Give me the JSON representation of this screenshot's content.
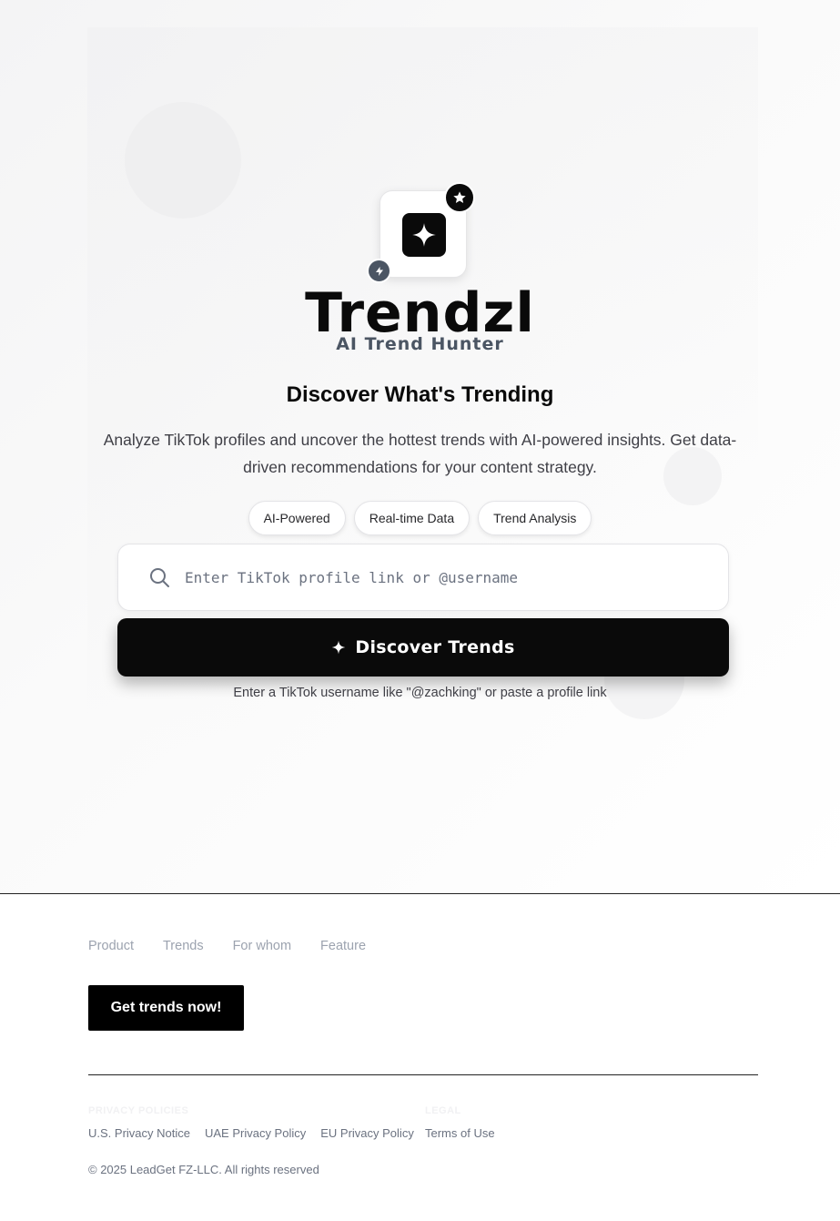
{
  "brand": {
    "name": "Trendzl",
    "tagline": "AI Trend Hunter"
  },
  "hero": {
    "headline": "Discover What's Trending",
    "subtext": "Analyze TikTok profiles and uncover the hottest trends with AI-powered insights. Get data-driven recommendations for your content strategy.",
    "features": [
      "AI-Powered",
      "Real-time Data",
      "Trend Analysis"
    ],
    "search": {
      "placeholder": "Enter TikTok profile link or @username",
      "value": ""
    },
    "cta_label": "Discover Trends",
    "hint": "Enter a TikTok username like \"@zachking\" or paste a profile link"
  },
  "footer": {
    "nav": [
      "Product",
      "Trends",
      "For whom",
      "Feature"
    ],
    "cta_label": "Get trends now!",
    "privacy_heading": "PRIVACY POLICIES",
    "privacy_links": [
      "U.S. Privacy Notice",
      "UAE Privacy Policy",
      "EU Privacy Policy"
    ],
    "legal_heading": "LEGAL",
    "legal_links": [
      "Terms of Use"
    ],
    "copyright": "© 2025 LeadGet FZ-LLC. All rights reserved"
  },
  "icons": {
    "logo": "sparkle-icon",
    "badge_top": "star-icon",
    "badge_bottom": "lightning-icon",
    "search": "search-icon",
    "cta": "sparkle-icon"
  },
  "colors": {
    "primary": "#0a0a0a",
    "muted_text": "#6b7280",
    "badge_gray": "#4b5563"
  }
}
